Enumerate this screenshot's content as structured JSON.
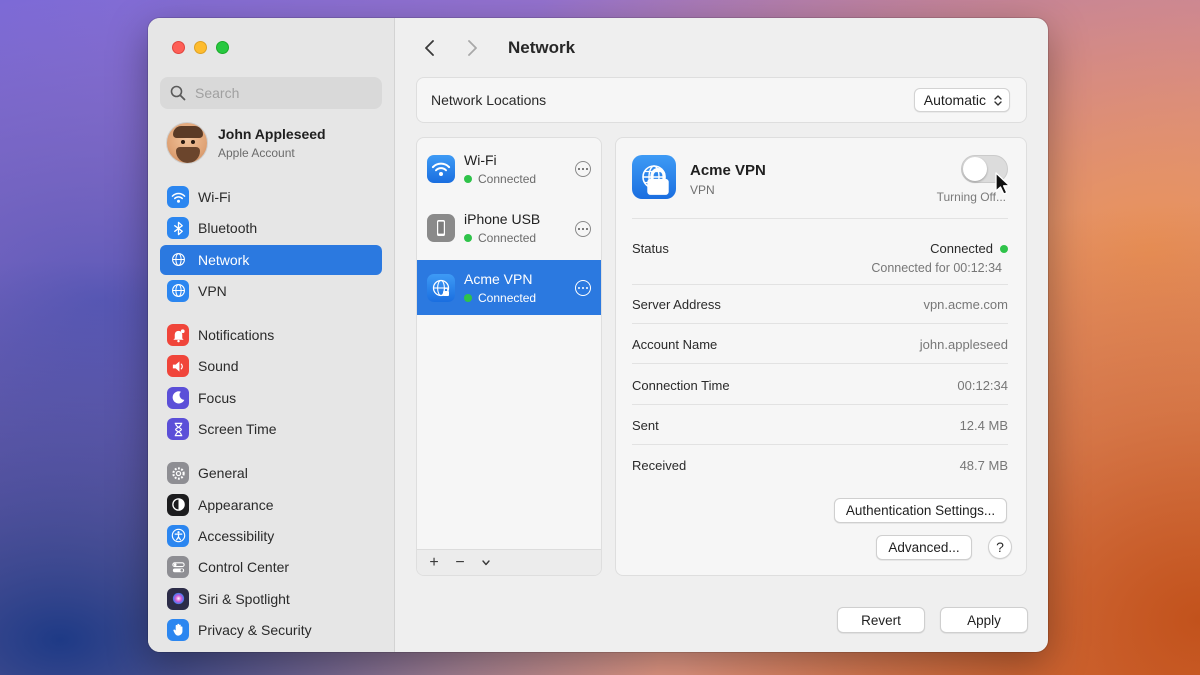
{
  "window": {
    "title": "Network"
  },
  "sidebar": {
    "search_placeholder": "Search",
    "account": {
      "name": "John Appleseed",
      "subtitle": "Apple Account"
    },
    "groups": [
      [
        {
          "label": "Wi-Fi",
          "icon": "wifi-icon",
          "color": "#2b86f0",
          "active": false
        },
        {
          "label": "Bluetooth",
          "icon": "bluetooth-icon",
          "color": "#2b86f0",
          "active": false
        },
        {
          "label": "Network",
          "icon": "globe-icon",
          "color": "#2b86f0",
          "active": true
        },
        {
          "label": "VPN",
          "icon": "globe-icon",
          "color": "#2b86f0",
          "active": false
        }
      ],
      [
        {
          "label": "Notifications",
          "icon": "bell-icon",
          "color": "#f0453a",
          "active": false
        },
        {
          "label": "Sound",
          "icon": "speaker-icon",
          "color": "#f0453a",
          "active": false
        },
        {
          "label": "Focus",
          "icon": "moon-icon",
          "color": "#5b4fd8",
          "active": false
        },
        {
          "label": "Screen Time",
          "icon": "hourglass-icon",
          "color": "#5b4fd8",
          "active": false
        }
      ],
      [
        {
          "label": "General",
          "icon": "gear-icon",
          "color": "#8e8e93",
          "active": false
        },
        {
          "label": "Appearance",
          "icon": "appearance-icon",
          "color": "#1c1c1e",
          "active": false
        },
        {
          "label": "Accessibility",
          "icon": "accessibility-icon",
          "color": "#2b86f0",
          "active": false
        },
        {
          "label": "Control Center",
          "icon": "toggles-icon",
          "color": "#8e8e93",
          "active": false
        },
        {
          "label": "Siri & Spotlight",
          "icon": "siri-icon",
          "color": "#2c2c48",
          "active": false
        },
        {
          "label": "Privacy & Security",
          "icon": "hand-icon",
          "color": "#2b86f0",
          "active": false
        }
      ]
    ]
  },
  "network_locations": {
    "label": "Network Locations",
    "value": "Automatic"
  },
  "services": [
    {
      "name": "Wi-Fi",
      "status": "Connected",
      "icon": "wifi-icon",
      "active": false
    },
    {
      "name": "iPhone USB",
      "status": "Connected",
      "icon": "iphone-icon",
      "active": false
    },
    {
      "name": "Acme VPN",
      "status": "Connected",
      "icon": "globe-lock-icon",
      "active": true
    }
  ],
  "list_controls": {
    "add": "+",
    "remove": "−"
  },
  "detail": {
    "title": "Acme VPN",
    "subtitle": "VPN",
    "toggle_note": "Turning Off...",
    "toggle_on": false,
    "status": {
      "label": "Status",
      "value": "Connected",
      "duration": "Connected for 00:12:34",
      "color": "#2fc34a"
    },
    "rows": [
      {
        "label": "Server Address",
        "value": "vpn.acme.com"
      },
      {
        "label": "Account Name",
        "value": "john.appleseed"
      },
      {
        "label": "Connection Time",
        "value": "00:12:34"
      },
      {
        "label": "Sent",
        "value": "12.4 MB"
      },
      {
        "label": "Received",
        "value": "48.7 MB"
      }
    ],
    "auth_button": "Authentication Settings...",
    "advanced_button": "Advanced...",
    "help_button": "?"
  },
  "footer": {
    "revert": "Revert",
    "apply": "Apply"
  }
}
